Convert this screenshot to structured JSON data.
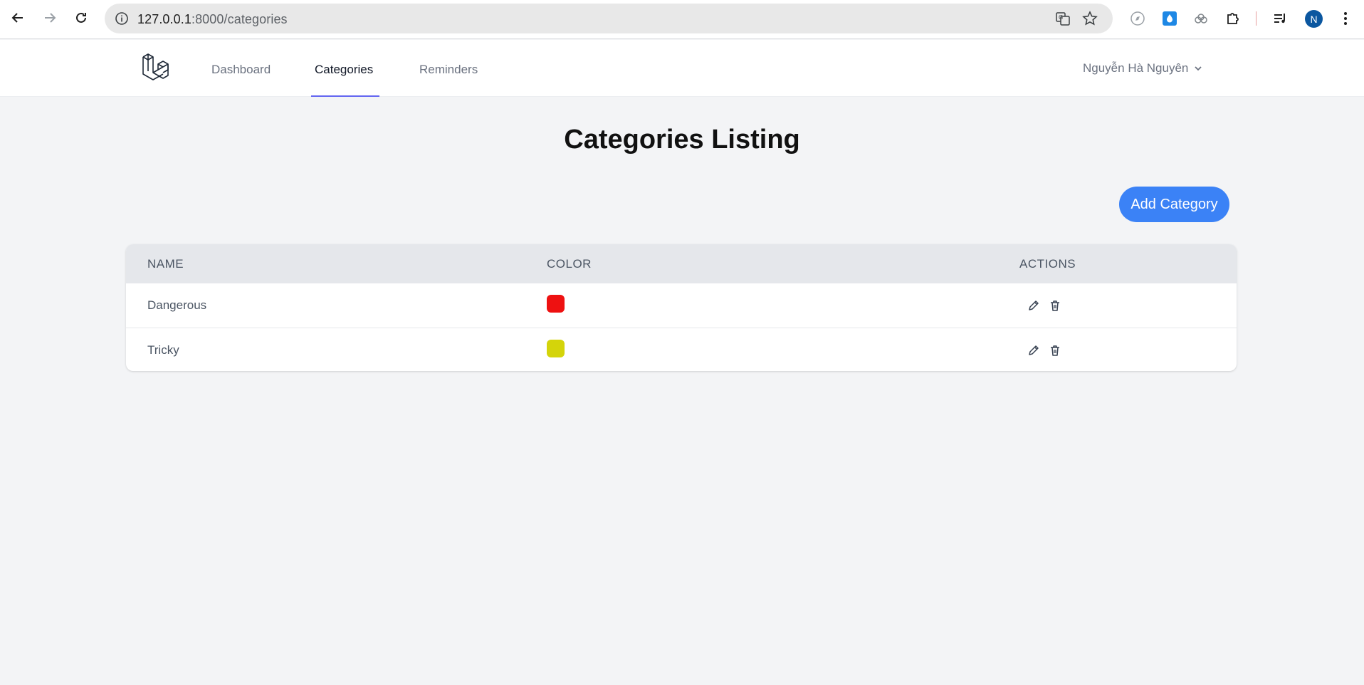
{
  "browser": {
    "url_host": "127.0.0.1",
    "url_path": ":8000/categories",
    "profile_initial": "N"
  },
  "header": {
    "nav": [
      {
        "label": "Dashboard"
      },
      {
        "label": "Categories",
        "active": true
      },
      {
        "label": "Reminders"
      }
    ],
    "user_name": "Nguyễn Hà Nguyên"
  },
  "main": {
    "title": "Categories Listing",
    "add_button": "Add Category",
    "table": {
      "headers": [
        "NAME",
        "COLOR",
        "ACTIONS"
      ],
      "rows": [
        {
          "name": "Dangerous",
          "color": "#ee1111"
        },
        {
          "name": "Tricky",
          "color": "#d4d40a"
        }
      ]
    }
  },
  "icons": {
    "edit": "pencil-icon",
    "delete": "trash-icon"
  },
  "colors": {
    "accent": "#3b82f6",
    "nav_underline": "#6366f1"
  }
}
